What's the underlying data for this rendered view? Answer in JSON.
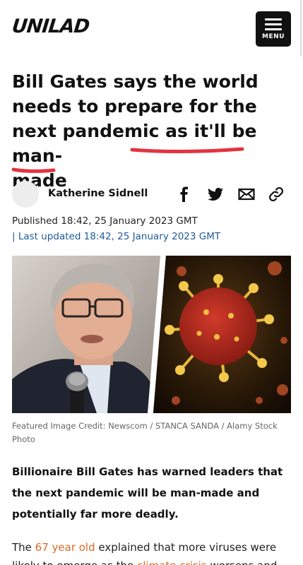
{
  "header": {
    "logo": "UNILAD",
    "menu_label": "MENU"
  },
  "article": {
    "headline_pre": "Bill Gates says the world needs to prepare for the next pandemic as ",
    "headline_highlight_1": "it'll be man-",
    "headline_highlight_2": "made",
    "author": "Katherine Sidnell",
    "published": "Published 18:42, 25 January 2023 GMT",
    "updated": "| Last updated 18:42, 25 January 2023 GMT",
    "image_credit": "Featured Image Credit: Newscom / STANCA SANDA / Alamy Stock Photo",
    "lede": "Billionaire Bill Gates has warned leaders that the next pandemic will be man-made and potentially far more deadly.",
    "body_pre": "The ",
    "body_link1": "67 year old",
    "body_mid": " explained that more viruses were likely to emerge as the ",
    "body_link2": "climate crisis",
    "body_post": " worsens and"
  },
  "share": {
    "icons": [
      "facebook-icon",
      "twitter-icon",
      "email-icon",
      "link-icon"
    ]
  },
  "colors": {
    "highlight_underline": "#e2343f",
    "link": "#d9692a",
    "updated_text": "#1d5a9a"
  }
}
